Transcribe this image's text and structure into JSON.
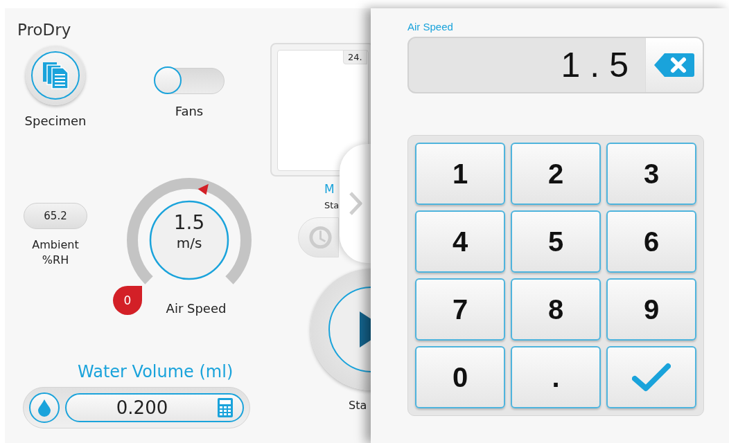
{
  "app": {
    "title": "ProDry"
  },
  "specimen": {
    "label": "Specimen"
  },
  "fans": {
    "label": "Fans",
    "on": false
  },
  "preview": {
    "tab": "24."
  },
  "mode": {
    "title": "M",
    "status": "Sta"
  },
  "ambient": {
    "value": "65.2",
    "label": "Ambient %RH"
  },
  "air_speed": {
    "value": "1.5",
    "unit": "m/s",
    "min": "0",
    "label": "Air Speed",
    "level": 0.57
  },
  "start": {
    "label": "Sta"
  },
  "water": {
    "title": "Water Volume (ml)",
    "value": "0.200"
  },
  "keypad": {
    "title": "Air Speed",
    "value": "1.5",
    "keys": [
      {
        "kind": "digit",
        "label": "1"
      },
      {
        "kind": "digit",
        "label": "2"
      },
      {
        "kind": "digit",
        "label": "3"
      },
      {
        "kind": "digit",
        "label": "4"
      },
      {
        "kind": "digit",
        "label": "5"
      },
      {
        "kind": "digit",
        "label": "6"
      },
      {
        "kind": "digit",
        "label": "7"
      },
      {
        "kind": "digit",
        "label": "8"
      },
      {
        "kind": "digit",
        "label": "9"
      },
      {
        "kind": "digit",
        "label": "0"
      },
      {
        "kind": "digit",
        "label": "."
      },
      {
        "kind": "confirm"
      }
    ]
  }
}
